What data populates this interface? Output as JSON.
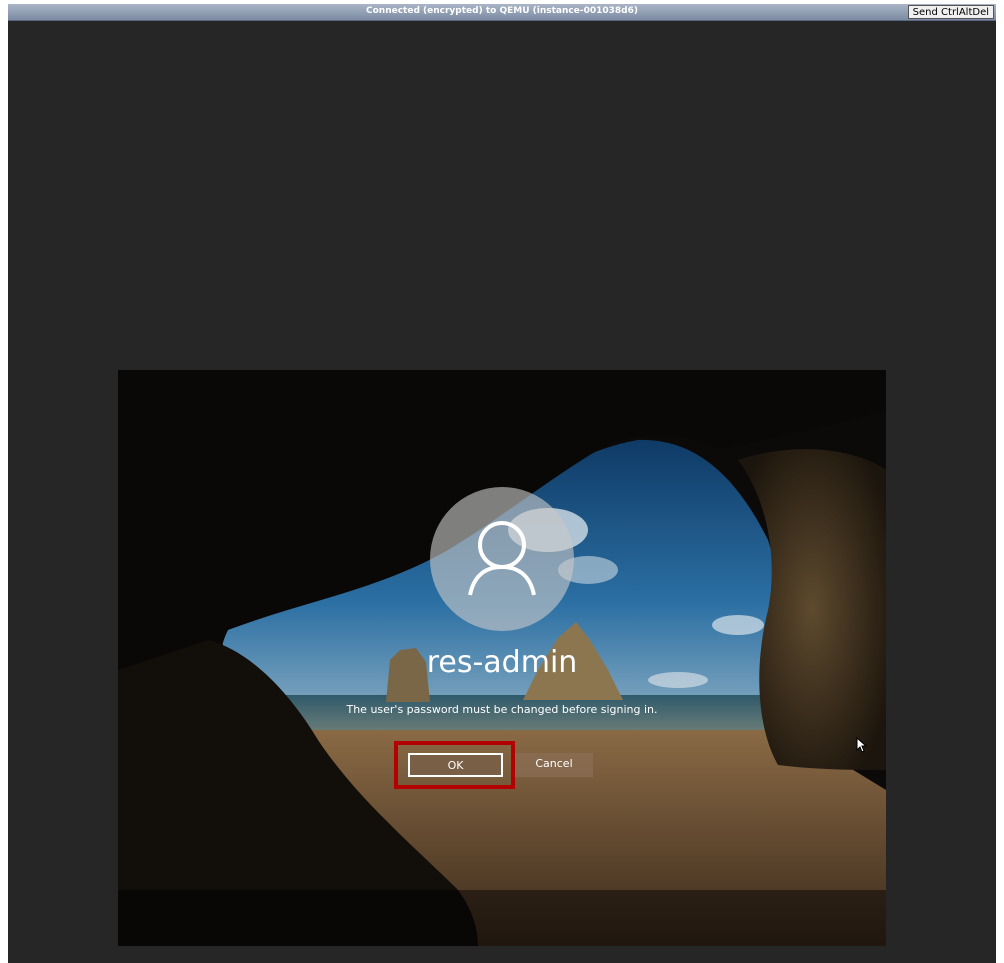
{
  "vnc": {
    "status_text": "Connected (encrypted) to QEMU (instance-001038d6)",
    "ctrl_alt_del_label": "Send CtrlAltDel"
  },
  "login": {
    "avatar_icon": "user-icon",
    "username": "res-admin",
    "message": "The user's password must be changed before signing in.",
    "ok_label": "OK",
    "cancel_label": "Cancel"
  },
  "colors": {
    "highlight": "#b30000",
    "background": "#262626"
  }
}
